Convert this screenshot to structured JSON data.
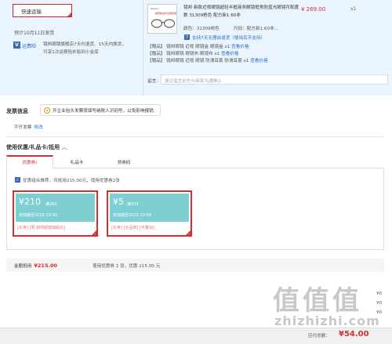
{
  "order": {
    "express_button": "快速运输",
    "estimate": "预计10月11日发货",
    "service_badge": "V",
    "service_link": "运费险",
    "service_text": "镜邦眼镜旗舰店7天内退货、15天内换货，可享1次运费险补贴到小金库",
    "product_image_label": "PayPen",
    "product_image_label2": "超轻防蓝光近视镜架",
    "product_title": "镜邦 新款近视眼镜超轻半框商务眼镜框男防蓝光眼镜可配度数 31309枪色 配方新1.60非",
    "price": "¥ 269.00",
    "qty": "x1",
    "color_spec": "颜色：31309枪色",
    "lens_spec": "尺码：配方新1.60非...",
    "promise_icon": "7",
    "promise": "支持7天无理由退货（使用后不支持）",
    "gifts": [
      {
        "prefix": "【赠品】",
        "text": "镜邦眼镜 近视 眼镜盒 眼镜盒 x1",
        "link": "查看价格"
      },
      {
        "prefix": "【赠品】",
        "text": "镜邦眼镜 眼镜布 眼镜布 x1",
        "link": "查看价格"
      },
      {
        "prefix": "【赠品】",
        "text": "镜邦眼镜 近视 眼镜 防滑耳套 防滑耳套 x1",
        "link": "查看价格"
      }
    ],
    "message_label": "留言:",
    "message_placeholder": "建议留言前先与商家沟通确认"
  },
  "invoice": {
    "heading": "发票信息",
    "option": "开企业抬头发票须填写纳税人识别号，以免影响报销",
    "status": "不开发票",
    "edit_link": "修改"
  },
  "coupons": {
    "heading": "使用优惠/礼品卡/抵用",
    "tabs": [
      {
        "label": "优惠券",
        "badge": "2"
      },
      {
        "label": "礼品卡"
      },
      {
        "label": "领劵码"
      }
    ],
    "optimal_text": "优惠组合推荐，共抵用215.00元，使用优惠券2张",
    "items": [
      {
        "amount": "¥210",
        "cond": "满269",
        "valid": "有效期至2023-10-10",
        "tags": "[东券] [限:镜邦眼镜旗舰店]"
      },
      {
        "amount": "¥5",
        "cond": "满105",
        "valid": "有效期至2023-10-04",
        "tags": "[东券] [全品类] [可叠加]"
      }
    ],
    "discount_label": "金额抵用",
    "discount_value": "¥215.00",
    "discount_note": "使用优惠券 2 张，优惠 215.00 元"
  },
  "summary": {
    "pay_label": "应付总额：",
    "pay_value": "¥54.00",
    "edge_values": [
      "¥0",
      "¥0",
      "¥0"
    ]
  },
  "watermark": {
    "glyphs": "值值值",
    "url": "zhizhizhi.com"
  },
  "colors": {
    "accent": "#d32f2f",
    "link": "#2b6bc6",
    "coupon": "#7ecfd1",
    "panel": "#eaf4fd"
  }
}
